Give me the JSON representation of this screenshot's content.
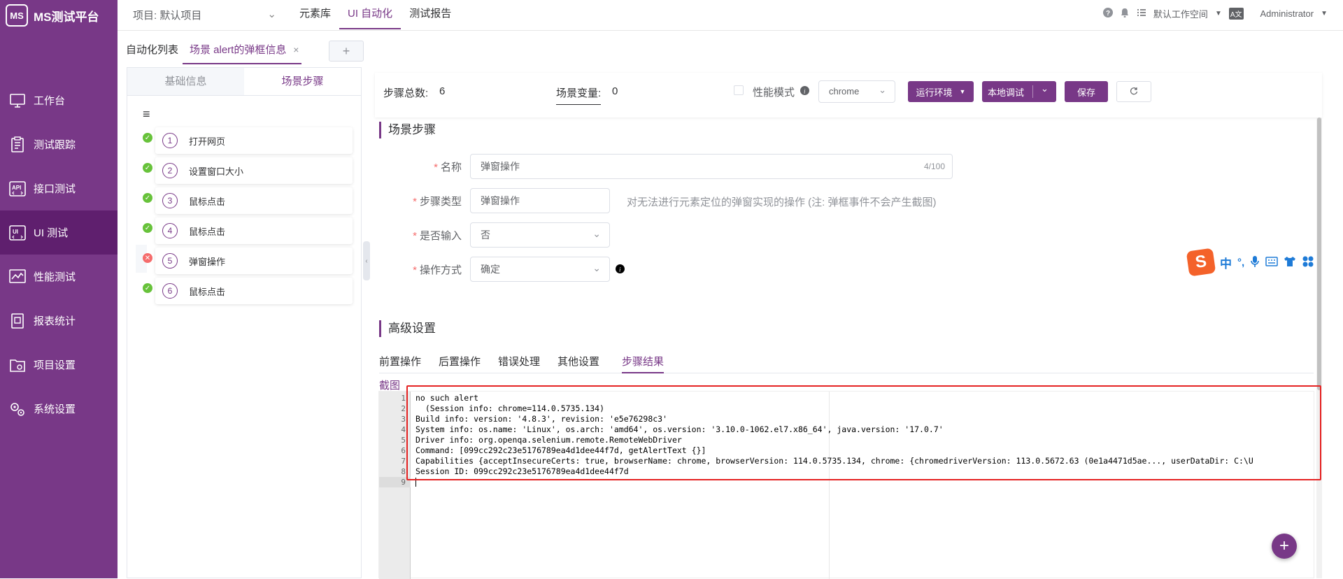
{
  "app": {
    "logo_text": "MS测试平台",
    "logo_mark": "MS"
  },
  "header": {
    "project_label": "项目: 默认项目",
    "nav": [
      "元素库",
      "UI 自动化",
      "测试报告"
    ],
    "workspace": "默认工作空间",
    "lang": "A文",
    "user": "Administrator"
  },
  "sidebar": {
    "items": [
      {
        "label": "工作台",
        "icon": "monitor-icon"
      },
      {
        "label": "测试跟踪",
        "icon": "clipboard-icon"
      },
      {
        "label": "接口测试",
        "icon": "api-icon"
      },
      {
        "label": "UI 测试",
        "icon": "ui-icon"
      },
      {
        "label": "性能测试",
        "icon": "chart-icon"
      },
      {
        "label": "报表统计",
        "icon": "report-icon"
      },
      {
        "label": "项目设置",
        "icon": "folder-icon"
      },
      {
        "label": "系统设置",
        "icon": "gear-icon"
      }
    ]
  },
  "tabs": {
    "list": "自动化列表",
    "scenario": "场景 alert的弹框信息",
    "close": "×",
    "add": "+"
  },
  "left_panel": {
    "tabs": [
      "基础信息",
      "场景步骤"
    ],
    "menu_icon": "≡",
    "steps": [
      {
        "num": "1",
        "label": "打开网页",
        "status": "ok"
      },
      {
        "num": "2",
        "label": "设置窗口大小",
        "status": "ok"
      },
      {
        "num": "3",
        "label": "鼠标点击",
        "status": "ok"
      },
      {
        "num": "4",
        "label": "鼠标点击",
        "status": "ok"
      },
      {
        "num": "5",
        "label": "弹窗操作",
        "status": "err"
      },
      {
        "num": "6",
        "label": "鼠标点击",
        "status": "ok"
      }
    ]
  },
  "toolbar": {
    "step_total_label": "步骤总数:",
    "step_total": "6",
    "scene_var_label": "场景变量:",
    "scene_var": "0",
    "perf_mode": "性能模式",
    "browser": "chrome",
    "env_btn": "运行环境",
    "debug_btn": "本地调试",
    "save_btn": "保存"
  },
  "form": {
    "section": "场景步骤",
    "name_label": "名称",
    "name_value": "弹窗操作",
    "name_counter": "4/100",
    "type_label": "步骤类型",
    "type_value": "弹窗操作",
    "type_hint": "对无法进行元素定位的弹窗实现的操作 (注: 弹框事件不会产生截图)",
    "input_label": "是否输入",
    "input_value": "否",
    "op_label": "操作方式",
    "op_value": "确定"
  },
  "advanced": {
    "section": "高级设置",
    "tabs": [
      "前置操作",
      "后置操作",
      "错误处理",
      "其他设置",
      "步骤结果"
    ],
    "screenshot_label": "截图"
  },
  "editor": {
    "lines": [
      "no such alert",
      "  (Session info: chrome=114.0.5735.134)",
      "Build info: version: '4.8.3', revision: 'e5e76298c3'",
      "System info: os.name: 'Linux', os.arch: 'amd64', os.version: '3.10.0-1062.el7.x86_64', java.version: '17.0.7'",
      "Driver info: org.openqa.selenium.remote.RemoteWebDriver",
      "Command: [099cc292c23e5176789ea4d1dee44f7d, getAlertText {}]",
      "Capabilities {acceptInsecureCerts: true, browserName: chrome, browserVersion: 114.0.5735.134, chrome: {chromedriverVersion: 113.0.5672.63 (0e1a4471d5ae..., userDataDir: C:\\U",
      "Session ID: 099cc292c23e5176789ea4d1dee44f7d",
      ""
    ]
  },
  "ime": {
    "zh": "中",
    "punct": "°,"
  },
  "fab": "+"
}
